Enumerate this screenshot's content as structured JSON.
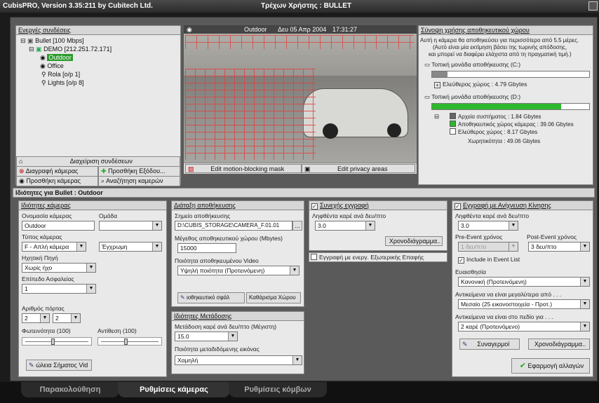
{
  "window": {
    "title": "CubisPRO, Version 3.35:211 by Cubitech Ltd.",
    "current_user": "Τρέχων Χρήστης : BULLET"
  },
  "connections": {
    "header": "Ενεργές συνδέσεις",
    "items": [
      "Bullet [100 Mbps]",
      "DEMO [212.251.72.171]",
      "Outdoor",
      "Office",
      "Rola [o/p 1]",
      "Lights [o/p 8]"
    ],
    "manage": "Διαχείριση συνδέσεων",
    "delete_camera": "Διαγραφή κάμερας",
    "add_output": "Προσθήκη Εξόδου...",
    "add_camera": "Προσθήκη κάμερας",
    "search_cameras": "Αναζήτηση καμερών"
  },
  "video": {
    "camera": "Outdoor",
    "date": "Δευ 05 Απρ 2004",
    "time": "17:31:27",
    "motion_mask": "Edit motion-blocking mask",
    "privacy": "Edit privacy areas"
  },
  "storage": {
    "header": "Σύνοψη χρήσης αποθηκευτικού χώρου",
    "note_line1": "Αυτή η κάμερα θα αποθηκεύσει για περισσότερο από 5.5 μέρες.",
    "note_line2": "(Αυτό είναι μία εκτίμηση βάσει της τωρινής απόδοσης,",
    "note_line3": "και μπορεί να διαφέρει ελάχιστα από τη πραγματική τιμή.)",
    "drive_c": "Τοπική μονάδα αποθήκευσης (C:)",
    "drive_c_used": 0.1,
    "free_c": "Ελεύθερος χώρος : 4.79 Gbytes",
    "drive_d": "Τοπική μονάδα αποθήκευσης (D:)",
    "drive_d_used": 0.82,
    "system_files": "Αρχεία συστήματος : 1.84 Gbytes",
    "camera_space": "Αποθηκευτικός χώρος κάμερας : 39.06 Gbytes",
    "free_d": "Ελεύθερος χώρος : 8.17 Gbytes",
    "capacity": "Χωρητικότητα : 49.06 Gbytes"
  },
  "props": {
    "title": "Ιδιότητες για Bullet : Outdoor"
  },
  "camera_props": {
    "header": "Ιδιότητες κάμερας",
    "name_label": "Ονομασία κάμερας",
    "name": "Outdoor",
    "group_label": "Ομάδα",
    "group": "",
    "type_label": "Τύπος κάμερας",
    "type": "F - Απλή κάμερα",
    "color": "Έγχρωμη",
    "audio_label": "Ηχητική Πηγή",
    "audio": "Χωρίς ήχο",
    "security_label": "Επίπεδο Ασφαλείας",
    "security": "1",
    "port_label": "Αριθμός πόρτας",
    "port1": "2",
    "port2": "2",
    "brightness_label": "Φωτεινότητα (100)",
    "contrast_label": "Αντίθεση (100)",
    "brightness": 0.45,
    "contrast": 0.45,
    "video_signal": "ώλεια Σήματος Vid"
  },
  "storage_settings": {
    "header": "Διάταξη αποθήκευσης",
    "path_label": "Σημείο αποθήκευσης",
    "path": "D:\\CUBIS_STORAGE\\CAMERA_F.01.01",
    "browse": "...",
    "size_label": "Μέγεθος αποθηκευτικού χώρου (Mbytes)",
    "size": "15000",
    "quality_label": "Ποιότητα αποθηκευμένου Video",
    "quality": "Υψηλή ποιότητα (Προτεινόμενη)",
    "storage_btn": "ιοθηκευτικό σφάλ",
    "clear_btn": "Καθάρισμα Χώρου"
  },
  "transfer": {
    "header": "Ιδιότητες Μετάδοσης",
    "fps_label": "Μετάδοση καρέ ανά δευ/πτο (Μέγιστη)",
    "fps": "15.0",
    "quality_label": "Ποιότητα μεταδιδόμενης εικόνας",
    "quality": "Χαμηλή"
  },
  "continuous": {
    "header": "Συνεχής εγγραφή",
    "fps_label": "Ληφθέντα καρέ ανά δευ/πτο",
    "fps": "3.0",
    "schedule": "Χρονοδιάγραμμα..",
    "external": "Εγγραφή με ενεργ. Εξωτερικής Επαφής"
  },
  "motion": {
    "header": "Εγγραφή με Ανίχνευση Κίνησης",
    "fps_label": "Ληφθέντα καρέ ανά δευ/πτο",
    "fps": "3.0",
    "pre_label": "Pre-Event χρόνος",
    "pre": "1 δευ/πτο",
    "post_label": "Post-Event χρόνος",
    "post": "3 δευ/πτο",
    "event_list": "Include in Event List",
    "sens_label": "Ευαισθησία",
    "sens": "Κανονική (Προτεινόμενη)",
    "objects_label": "Αντικείμενα να είναι μεγαλύτερα από . . .",
    "objects": "Μεσαίο (25 εικονοστοιχεία - Προτ.)",
    "field_label": "Αντικείμενα να είναι στο πεδίο για . . .",
    "field": "2 καρέ (Προτεινόμενο)",
    "alarms": "Συναγερμοί",
    "schedule": "Χρονοδιάγραμμα..",
    "apply": "Εφαρμογή αλλαγών"
  },
  "tabs": [
    "Παρακολούθηση",
    "Ρυθμίσεις κάμερας",
    "Ρυθμίσεις κόμβων"
  ]
}
